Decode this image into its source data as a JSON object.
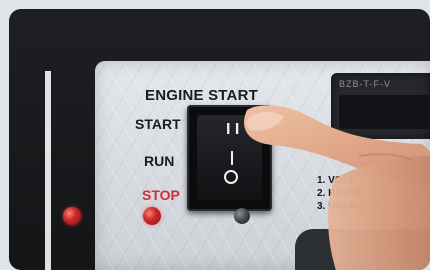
{
  "panel": {
    "title": "ENGINE START",
    "labels": {
      "start": "START",
      "run": "RUN",
      "stop": "STOP"
    },
    "switch_marks": {
      "on": "I I",
      "off": "O"
    },
    "display_text": "BZB-T-F-V",
    "list": [
      "1. VOLT",
      "2. HERTZ",
      "3. HOURS"
    ]
  },
  "colors": {
    "stop_label": "#d02c36",
    "led": "#cc2a2a"
  }
}
